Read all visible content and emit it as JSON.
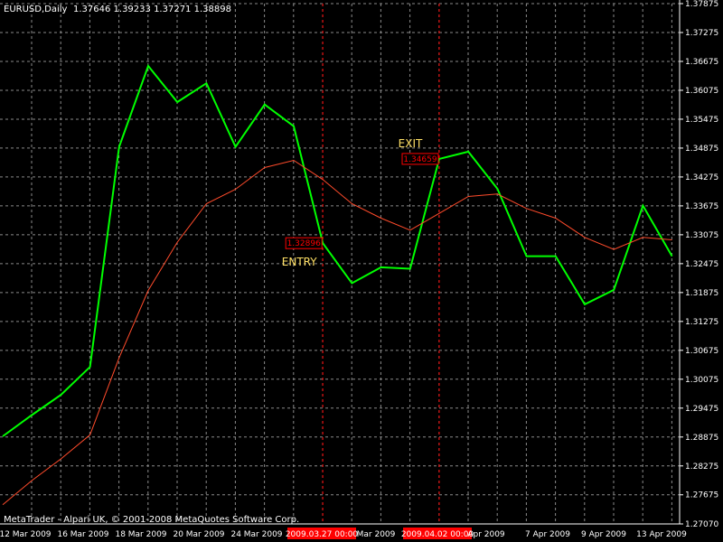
{
  "header": {
    "symbol_label": "EURUSD,Daily",
    "ohlc": "1.37646 1.39233 1.37271 1.38898"
  },
  "footer": {
    "copyright": "MetaTrader - Alpari UK, © 2001-2008 MetaQuotes Software Corp."
  },
  "colors": {
    "background": "#000000",
    "grid": "#8a8a8a",
    "price_line": "#00ff00",
    "ma_line": "#ff4b2b",
    "marker": "#ff0000",
    "annotation_text": "#ffe066"
  },
  "chart_data": {
    "type": "line",
    "title": "EURUSD,Daily",
    "x_tick_labels": [
      "12 Mar 2009",
      "16 Mar 2009",
      "18 Mar 2009",
      "20 Mar 2009",
      "24 Mar 2009",
      "2009.03.27 00:00",
      "Mar 2009",
      "2009.04.02 00:00",
      "Apr 2009",
      "7 Apr 2009",
      "9 Apr 2009",
      "13 Apr 2009"
    ],
    "y_tick_labels": [
      "1.37875",
      "1.37275",
      "1.36675",
      "1.36075",
      "1.35475",
      "1.34875",
      "1.34275",
      "1.33675",
      "1.33075",
      "1.32475",
      "1.31875",
      "1.31275",
      "1.30675",
      "1.30075",
      "1.29475",
      "1.28875",
      "1.28275",
      "1.27675",
      "1.27070"
    ],
    "ylim": [
      1.2707,
      1.37875
    ],
    "grid": true,
    "series": [
      {
        "color": "#00ff00",
        "values": [
          1.2889,
          1.2933,
          1.2975,
          1.3033,
          1.349,
          1.3658,
          1.3583,
          1.3622,
          1.349,
          1.3578,
          1.3533,
          1.329,
          1.3207,
          1.324,
          1.3237,
          1.3465,
          1.348,
          1.3403,
          1.3263,
          1.3263,
          1.3163,
          1.3193,
          1.3368,
          1.3263
        ]
      },
      {
        "color": "#ff4b2b",
        "values": [
          1.2747,
          1.2797,
          1.2842,
          1.2892,
          1.3052,
          1.3192,
          1.3292,
          1.3372,
          1.3402,
          1.3447,
          1.3462,
          1.3422,
          1.3372,
          1.3342,
          1.3317,
          1.3352,
          1.3387,
          1.3392,
          1.3362,
          1.3342,
          1.3302,
          1.3277,
          1.3302,
          1.3297
        ]
      }
    ],
    "annotations": [
      {
        "label": "ENTRY",
        "price": "1.32896",
        "index": 11
      },
      {
        "label": "EXIT",
        "price": "1.34659",
        "index": 15
      }
    ]
  }
}
